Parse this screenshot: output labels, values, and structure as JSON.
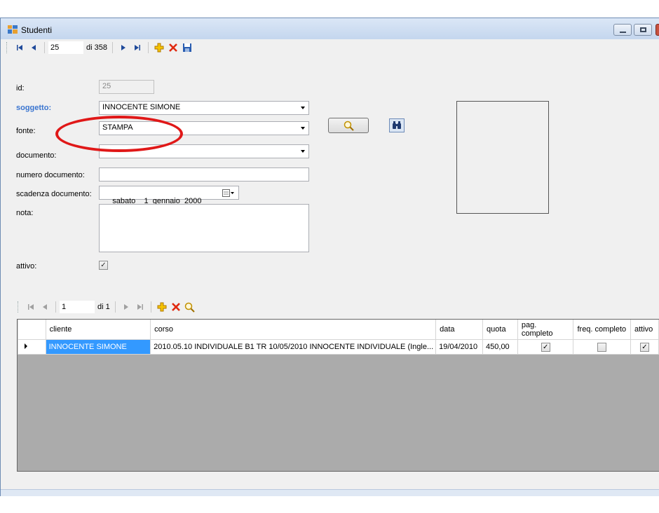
{
  "window": {
    "title": "Studenti"
  },
  "nav_main": {
    "position": "25",
    "count": "di 358"
  },
  "labels": {
    "id": "id:",
    "soggetto": "soggetto:",
    "fonte": "fonte:",
    "documento": "documento:",
    "numero_documento": "numero documento:",
    "scadenza_documento": "scadenza documento:",
    "nota": "nota:",
    "attivo": "attivo:"
  },
  "fields": {
    "id": "25",
    "soggetto": "INNOCENTE SIMONE",
    "fonte": "STAMPA",
    "documento": "",
    "numero_documento": "",
    "scadenza_documento": "sabato    1  gennaio  2000",
    "nota": "",
    "attivo_checked": "✓"
  },
  "nav_sub": {
    "position": "1",
    "count": "di 1"
  },
  "grid": {
    "columns": [
      "cliente",
      "corso",
      "data",
      "quota",
      "pag. completo",
      "freq. completo",
      "attivo"
    ],
    "rows": [
      {
        "cliente": "INNOCENTE SIMONE",
        "corso": "2010.05.10 INDIVIDUALE B1 TR 10/05/2010 INNOCENTE INDIVIDUALE (Ingle...",
        "data": "19/04/2010",
        "quota": "450,00",
        "pag_completo": "✓",
        "freq_completo": "",
        "attivo": "✓"
      }
    ]
  },
  "icons": {
    "first": "first-record-icon",
    "prev": "previous-record-icon",
    "next": "next-record-icon",
    "last": "last-record-icon",
    "add": "add-icon",
    "delete": "delete-icon",
    "save": "save-icon",
    "search": "magnifier-icon",
    "binoculars": "binoculars-icon"
  },
  "colors": {
    "selection": "#3399ff",
    "label_highlight": "#3a75d0",
    "annotation_ellipse": "#e01818"
  }
}
